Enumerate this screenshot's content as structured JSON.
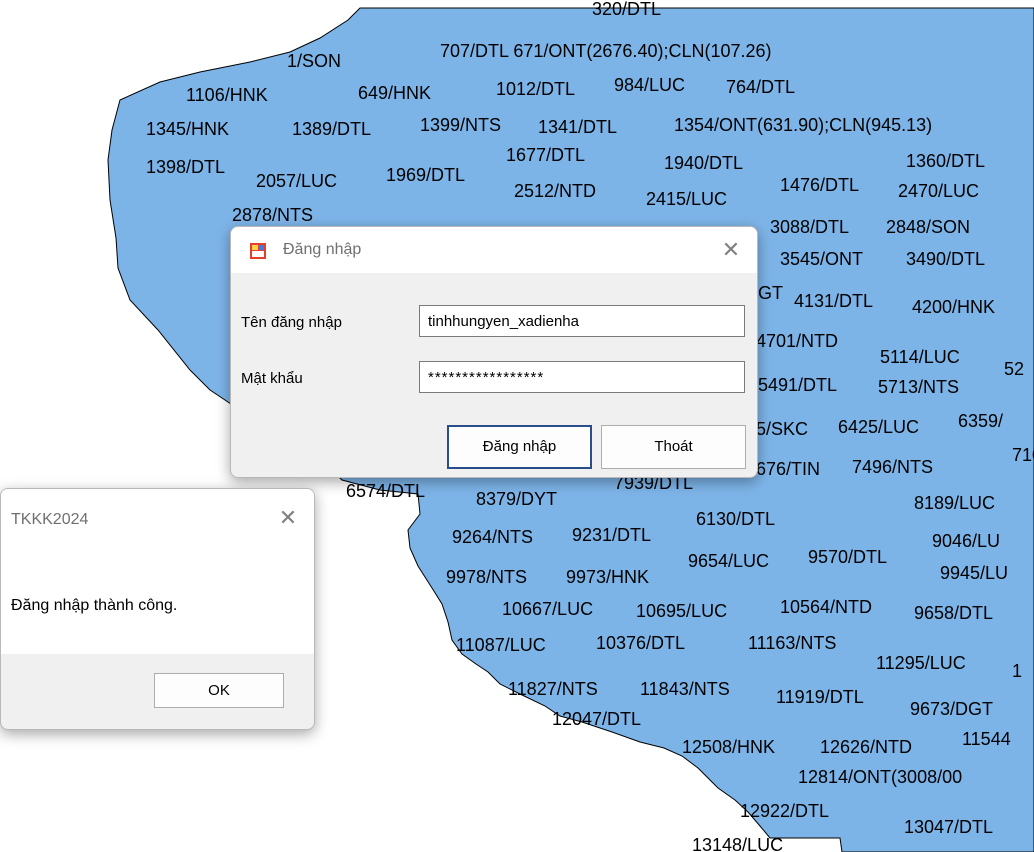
{
  "map": {
    "fill_color": "#7db4e8",
    "stroke_color": "#000000",
    "labels": [
      "320/DTL",
      "1/SON",
      "707/DTL 671/ONT(2676.40);CLN(107.26)",
      "1106/HNK",
      "649/HNK",
      "1012/DTL",
      "984/LUC",
      "764/DTL",
      "1345/HNK",
      "1389/DTL",
      "1399/NTS",
      "1341/DTL",
      "1354/ONT(631.90);CLN(945.13)",
      "1398/DTL",
      "2057/LUC",
      "1969/DTL",
      "1677/DTL",
      "2512/NTD",
      "2415/LUC",
      "1940/DTL",
      "1476/DTL",
      "1360/DTL",
      "2470/LUC",
      "2878/NTS",
      "3088/DTL",
      "2848/SON",
      "3545/ONT",
      "3490/DTL",
      "GT",
      "4131/DTL",
      "4200/HNK",
      "4701/NTD",
      "5114/LUC",
      "52",
      "5491/DTL",
      "5713/NTS",
      "5/SKC",
      "6425/LUC",
      "6359/",
      "676/TIN",
      "7496/NTS",
      "710",
      "6574/DTL",
      "7939/DTL",
      "8379/DYT",
      "6130/DTL",
      "8189/LUC",
      "9264/NTS",
      "9231/DTL",
      "9046/LU",
      "9978/NTS",
      "9973/HNK",
      "9654/LUC",
      "9570/DTL",
      "9945/LU",
      "10667/LUC",
      "10695/LUC",
      "10564/NTD",
      "9658/DTL",
      "11087/LUC",
      "10376/DTL",
      "11163/NTS",
      "11295/LUC",
      "1",
      "11827/NTS",
      "11843/NTS",
      "11919/DTL",
      "9673/DGT",
      "12047/DTL",
      "12508/HNK",
      "12626/NTD",
      "11544",
      "12814/ONT(3008/00",
      "12922/DTL",
      "13047/DTL",
      "13148/LUC"
    ]
  },
  "login_dialog": {
    "title": "Đăng nhập",
    "close_glyph": "✕",
    "username_label": "Tên đăng nhập",
    "username_value": "tinhhungyen_xadienha",
    "password_label": "Mật khẩu",
    "password_value": "*****************",
    "submit_label": "Đăng nhập",
    "exit_label": "Thoát",
    "app_icon": "form-app-icon"
  },
  "message_box": {
    "title": "TKKK2024",
    "close_glyph": "✕",
    "message": "Đăng nhập thành công.",
    "ok_label": "OK"
  }
}
